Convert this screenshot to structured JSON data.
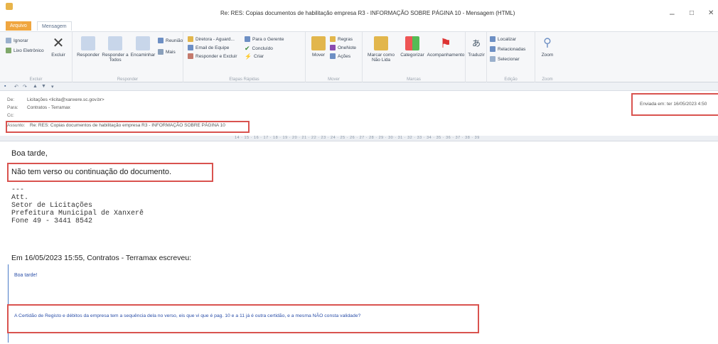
{
  "window": {
    "title": "Re: RES: Copias documentos de habilitação empresa R3 - INFORMAÇÃO SOBRE PÁGINA 10 - Mensagem (HTML)",
    "tabs": [
      "Arquivo",
      "Mensagem"
    ],
    "controls": {
      "minimize": "–",
      "restore": "□",
      "close": "✕"
    }
  },
  "ribbon": {
    "excluir": {
      "ignore": "Ignorar",
      "junk": "Lixo Eletrônico",
      "delete": "Excluir",
      "group": "Excluir"
    },
    "responder": {
      "reply": "Responder",
      "reply_all": "Responder a Todos",
      "forward": "Encaminhar",
      "meeting": "Reunião",
      "more": "Mais",
      "group": "Responder"
    },
    "etapas": {
      "item1": "Diretora - Aguard...",
      "item2": "Email de Equipe",
      "item3": "Responder e Excluir",
      "item4": "Para o Gerente",
      "item5": "Concluído",
      "item6": "Criar",
      "group": "Etapas Rápidas"
    },
    "mover": {
      "move": "Mover",
      "rules": "Regras",
      "onenote": "OneNote",
      "actions": "Ações",
      "group": "Mover"
    },
    "marcas": {
      "unread": "Marcar como Não Lida",
      "categorize": "Categorizar",
      "followup": "Acompanhamento",
      "group": "Marcas"
    },
    "translate": {
      "label": "Traduzir"
    },
    "edicao": {
      "find": "Localizar",
      "related": "Relacionadas",
      "select": "Selecionar",
      "group": "Edição"
    },
    "zoom": {
      "label": "Zoom",
      "group": "Zoom"
    }
  },
  "header": {
    "from_label": "De:",
    "from": "Licitações <licita@xanxere.sc.gov.br>",
    "to_label": "Para:",
    "to": "Contratos - Terramax",
    "cc_label": "Cc:",
    "subject_label": "Assunto:",
    "subject": "Re: RES: Copias documentos de habilitação empresa R3 - INFORMAÇÃO SOBRE PÁGINA 10",
    "sent_label": "Enviada em:",
    "sent": "ter 16/05/2023 4:50"
  },
  "ruler": "14 · 15 · 16 · 17 · 18 · 19 · 20 · 21 · 22 · 23 · 24 · 25 · 26 · 27 · 28 · 29 · 30 · 31 · 32 · 33 · 34 · 35 · 36 · 37 · 38 · 39",
  "body": {
    "greeting": "Boa tarde,",
    "main_line": "Não tem verso ou continuação do documento.",
    "signature": "---\nAtt.\nSetor de Licitações\nPrefeitura Municipal de Xanxerê\nFone 49 - 3441 8542",
    "quote_header": "Em 16/05/2023 15:55, Contratos - Terramax escreveu:",
    "quote_greeting": "Boa tarde!",
    "quote_text": "A Certidão de Registo e débitos da empresa tem a sequência dela no verso, eis que vi que é pag. 10 e a 11 já é outra certidão, e a mesma NÃO consta validade?"
  }
}
